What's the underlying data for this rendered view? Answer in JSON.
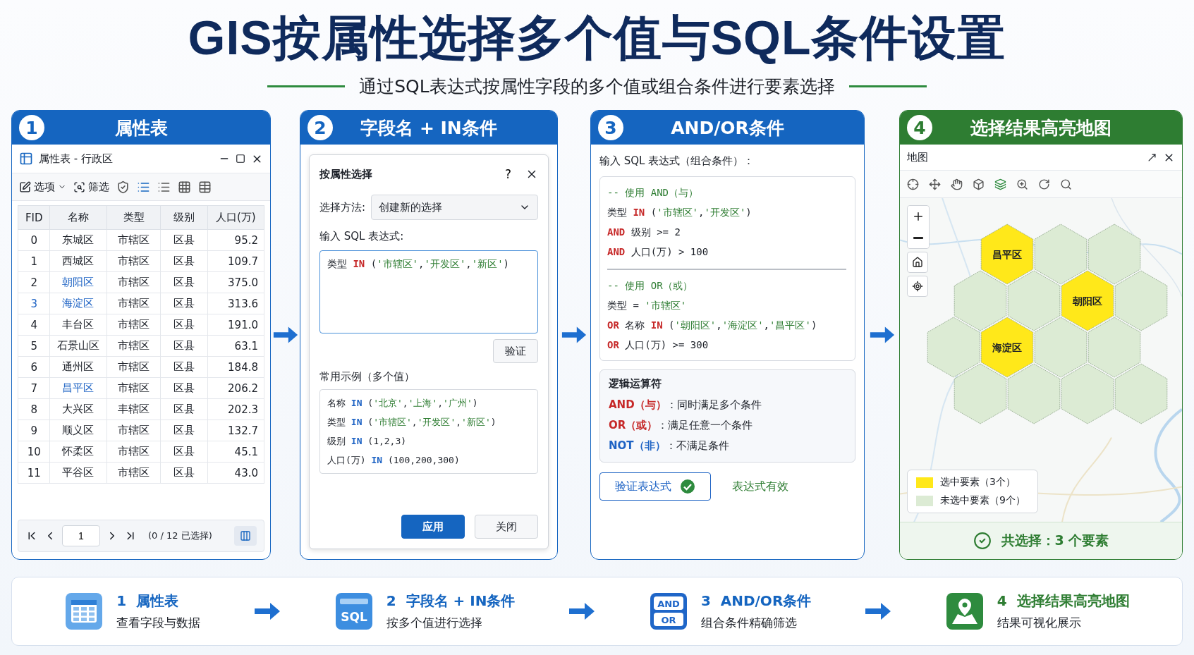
{
  "title": "GIS按属性选择多个值与SQL条件设置",
  "subtitle": "通过SQL表达式按属性字段的多个值或组合条件进行要素选择",
  "steps": [
    {
      "kind": "table",
      "number": "1",
      "header": "属性表",
      "color": "#1565c0",
      "window_title": "属性表 - 行政区",
      "toolbar": {
        "options": "选项",
        "filter": "筛选",
        "views": [
          {
            "kind": "shield",
            "selected": false
          },
          {
            "kind": "list",
            "selected": true
          },
          {
            "kind": "list",
            "selected": false
          },
          {
            "kind": "grid",
            "selected": false
          },
          {
            "kind": "table",
            "selected": false
          }
        ]
      },
      "columns": [
        "FID",
        "名称",
        "类型",
        "级别",
        "人口(万)"
      ],
      "rows": [
        {
          "fid": "0",
          "name": "东城区",
          "type": "市辖区",
          "level": "区县",
          "pop": "95.2",
          "fid_marked": false,
          "name_marked": false
        },
        {
          "fid": "1",
          "name": "西城区",
          "type": "市辖区",
          "level": "区县",
          "pop": "109.7",
          "fid_marked": false,
          "name_marked": false
        },
        {
          "fid": "2",
          "name": "朝阳区",
          "type": "市辖区",
          "level": "区县",
          "pop": "375.0",
          "fid_marked": false,
          "name_marked": true
        },
        {
          "fid": "3",
          "name": "海淀区",
          "type": "市辖区",
          "level": "区县",
          "pop": "313.6",
          "fid_marked": true,
          "name_marked": true
        },
        {
          "fid": "4",
          "name": "丰台区",
          "type": "市辖区",
          "level": "区县",
          "pop": "191.0",
          "fid_marked": false,
          "name_marked": false
        },
        {
          "fid": "5",
          "name": "石景山区",
          "type": "市辖区",
          "level": "区县",
          "pop": "63.1",
          "fid_marked": false,
          "name_marked": false
        },
        {
          "fid": "6",
          "name": "通州区",
          "type": "市辖区",
          "level": "区县",
          "pop": "184.8",
          "fid_marked": false,
          "name_marked": false
        },
        {
          "fid": "7",
          "name": "昌平区",
          "type": "市辖区",
          "level": "区县",
          "pop": "206.2",
          "fid_marked": false,
          "name_marked": true
        },
        {
          "fid": "8",
          "name": "大兴区",
          "type": "丰辖区",
          "level": "区县",
          "pop": "202.3",
          "fid_marked": false,
          "name_marked": false
        },
        {
          "fid": "9",
          "name": "顺义区",
          "type": "市辖区",
          "level": "区县",
          "pop": "132.7",
          "fid_marked": false,
          "name_marked": false
        },
        {
          "fid": "10",
          "name": "怀柔区",
          "type": "市辖区",
          "level": "区县",
          "pop": "45.1",
          "fid_marked": false,
          "name_marked": false
        },
        {
          "fid": "11",
          "name": "平谷区",
          "type": "市辖区",
          "level": "区县",
          "pop": "43.0",
          "fid_marked": false,
          "name_marked": false
        }
      ],
      "pager": {
        "page": "1",
        "status": "(0 / 12 已选择)"
      }
    },
    {
      "kind": "dialog",
      "number": "2",
      "header": "字段名 + IN条件",
      "color": "#1565c0",
      "dialog_title": "按属性选择",
      "help": "?",
      "method_label": "选择方法:",
      "method_value": "创建新的选择",
      "expression_label": "输入 SQL 表达式:",
      "expression": [
        {
          "text": "类型 ",
          "kind": "plain"
        },
        {
          "text": "IN",
          "kind": "keyword"
        },
        {
          "text": " (",
          "kind": "plain"
        },
        {
          "text": "'市辖区'",
          "kind": "string"
        },
        {
          "text": ",",
          "kind": "plain"
        },
        {
          "text": "'开发区'",
          "kind": "string"
        },
        {
          "text": ",",
          "kind": "plain"
        },
        {
          "text": "'新区'",
          "kind": "string"
        },
        {
          "text": ")",
          "kind": "plain"
        }
      ],
      "verify": "验证",
      "examples_label": "常用示例（多个值）",
      "examples": [
        [
          {
            "text": "名称 ",
            "kind": "plain"
          },
          {
            "text": "IN",
            "kind": "operator"
          },
          {
            "text": " (",
            "kind": "plain"
          },
          {
            "text": "'北京'",
            "kind": "string"
          },
          {
            "text": ",",
            "kind": "plain"
          },
          {
            "text": "'上海'",
            "kind": "string"
          },
          {
            "text": ",",
            "kind": "plain"
          },
          {
            "text": "'广州'",
            "kind": "string"
          },
          {
            "text": ")",
            "kind": "plain"
          }
        ],
        [
          {
            "text": "类型 ",
            "kind": "plain"
          },
          {
            "text": "IN",
            "kind": "operator"
          },
          {
            "text": " (",
            "kind": "plain"
          },
          {
            "text": "'市辖区'",
            "kind": "string"
          },
          {
            "text": ",",
            "kind": "plain"
          },
          {
            "text": "'开发区'",
            "kind": "string"
          },
          {
            "text": ",",
            "kind": "plain"
          },
          {
            "text": "'新区'",
            "kind": "string"
          },
          {
            "text": ")",
            "kind": "plain"
          }
        ],
        [
          {
            "text": "级别 ",
            "kind": "plain"
          },
          {
            "text": "IN",
            "kind": "operator"
          },
          {
            "text": " (1,2,3)",
            "kind": "plain"
          }
        ],
        [
          {
            "text": "人口(万) ",
            "kind": "plain"
          },
          {
            "text": "IN",
            "kind": "operator"
          },
          {
            "text": " (100,200,300)",
            "kind": "plain"
          }
        ]
      ],
      "buttons": [
        {
          "label": "应用",
          "primary": true
        },
        {
          "label": "关闭",
          "primary": false
        }
      ]
    },
    {
      "kind": "conditions",
      "number": "3",
      "header": "AND/OR条件",
      "color": "#1565c0",
      "label": "输入 SQL 表达式（组合条件）：",
      "groups": [
        [
          [
            {
              "text": "-- 使用 AND（与）",
              "kind": "comment"
            }
          ],
          [
            {
              "text": "类型 ",
              "kind": "plain"
            },
            {
              "text": "IN",
              "kind": "keyword"
            },
            {
              "text": " (",
              "kind": "plain"
            },
            {
              "text": "'市辖区'",
              "kind": "string"
            },
            {
              "text": ",",
              "kind": "plain"
            },
            {
              "text": "'开发区'",
              "kind": "string"
            },
            {
              "text": ")",
              "kind": "plain"
            }
          ],
          [
            {
              "text": "AND",
              "kind": "keyword"
            },
            {
              "text": " 级别 >= 2",
              "kind": "plain"
            }
          ],
          [
            {
              "text": "AND",
              "kind": "keyword"
            },
            {
              "text": " 人口(万) > 100",
              "kind": "plain"
            }
          ]
        ],
        [
          [
            {
              "text": "-- 使用 OR（或）",
              "kind": "comment"
            }
          ],
          [
            {
              "text": "类型 = ",
              "kind": "plain"
            },
            {
              "text": "'市辖区'",
              "kind": "string"
            }
          ],
          [
            {
              "text": "OR",
              "kind": "keyword"
            },
            {
              "text": " 名称 ",
              "kind": "plain"
            },
            {
              "text": "IN",
              "kind": "keyword"
            },
            {
              "text": " (",
              "kind": "plain"
            },
            {
              "text": "'朝阳区'",
              "kind": "string"
            },
            {
              "text": ",",
              "kind": "plain"
            },
            {
              "text": "'海淀区'",
              "kind": "string"
            },
            {
              "text": ",",
              "kind": "plain"
            },
            {
              "text": "'昌平区'",
              "kind": "string"
            },
            {
              "text": ")",
              "kind": "plain"
            }
          ],
          [
            {
              "text": "OR",
              "kind": "keyword"
            },
            {
              "text": " 人口(万) >= 300",
              "kind": "plain"
            }
          ]
        ]
      ],
      "operators_title": "逻辑运算符",
      "operators": [
        [
          {
            "text": "AND（与）",
            "kind": "keyword"
          },
          {
            "text": "：同时满足多个条件",
            "kind": "plain"
          }
        ],
        [
          {
            "text": "OR（或）",
            "kind": "keyword"
          },
          {
            "text": "：满足任意一个条件",
            "kind": "plain"
          }
        ],
        [
          {
            "text": "NOT（非）",
            "kind": "operator"
          },
          {
            "text": "：不满足条件",
            "kind": "plain"
          }
        ]
      ],
      "verify": "验证表达式",
      "status": "表达式有效"
    },
    {
      "kind": "map",
      "number": "4",
      "header": "选择结果高亮地图",
      "color": "#2e7d32",
      "window_title": "地图",
      "tools": [
        {
          "kind": "target",
          "selected": false
        },
        {
          "kind": "move",
          "selected": false
        },
        {
          "kind": "hand",
          "selected": false
        },
        {
          "kind": "box",
          "selected": false
        },
        {
          "kind": "layers",
          "selected": true
        },
        {
          "kind": "zoom",
          "selected": false
        },
        {
          "kind": "rotate",
          "selected": false
        },
        {
          "kind": "search",
          "selected": false
        }
      ],
      "regions": [
        {
          "selected": false
        },
        {
          "selected": false
        },
        {
          "selected": false
        },
        {
          "selected": false
        },
        {
          "selected": false
        },
        {
          "selected": false
        },
        {
          "selected": false
        },
        {
          "selected": false
        },
        {
          "selected": false
        },
        {
          "selected": false
        },
        {
          "selected": false
        },
        {
          "selected": false
        },
        {
          "selected": true,
          "label": "昌平区"
        },
        {
          "selected": true,
          "label": "海淀区"
        },
        {
          "selected": true,
          "label": "朝阳区"
        }
      ],
      "legend": [
        {
          "label": "选中要素（3个）",
          "color": "#ffe81a"
        },
        {
          "label": "未选中要素（9个）",
          "color": "#dcebd4"
        }
      ],
      "summary": "共选择：3 个要素"
    }
  ],
  "flow": [
    {
      "kind": "table",
      "number": "1",
      "title": "属性表",
      "caption": "查看字段与数据",
      "color": "#1565c0"
    },
    {
      "kind": "sql",
      "number": "2",
      "title": "字段名 + IN条件",
      "caption": "按多个值进行选择",
      "color": "#1565c0",
      "icon_text": [
        "SQL"
      ]
    },
    {
      "kind": "andor",
      "number": "3",
      "title": "AND/OR条件",
      "caption": "组合条件精确筛选",
      "color": "#1565c0",
      "icon_text": [
        "AND",
        "OR"
      ]
    },
    {
      "kind": "map",
      "number": "4",
      "title": "选择结果高亮地图",
      "caption": "结果可视化展示",
      "color": "#2e7d32"
    }
  ]
}
